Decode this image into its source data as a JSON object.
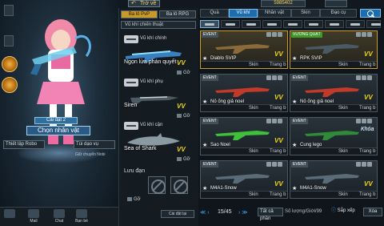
{
  "header": {
    "back_label": "Trở về",
    "currency_value": "5985402"
  },
  "character": {
    "settings_label": "Cài đặt 2",
    "choose_label": "Chọn nhân vật",
    "char_settings_label": "Thiết lập Robo",
    "mount_label": "Tùi dạo vụ",
    "anim_label": "Giữ chuyển Nobi"
  },
  "left_bottom": [
    {
      "label": ""
    },
    {
      "label": "Mail"
    },
    {
      "label": "Chat"
    },
    {
      "label": "Bạn bè"
    }
  ],
  "loadout": {
    "tabs": [
      "Ba lô PvP",
      "Ba lô RPG"
    ],
    "subtab": "Vũ khí chiến thuật",
    "slots": [
      {
        "cat": "Vũ khí chính",
        "name": "Ngọn lửa phán quyết",
        "vv": "VV",
        "stock": "Gỡ"
      },
      {
        "cat": "Vũ khí phụ",
        "name": "Siren",
        "vv": "VV",
        "stock": "Gỡ"
      },
      {
        "cat": "Vũ khí cận",
        "name": "Sea of Shark",
        "vv": "VV",
        "stock": "Gỡ"
      }
    ],
    "items_label": "Lưu đạn",
    "items_stock": "Gỡ",
    "reset_label": "Cài đặt lại"
  },
  "store": {
    "tabs": [
      "Quà",
      "Vũ khí",
      "Nhân vật",
      "Skin",
      "Đạo cụ"
    ],
    "active_tab": 1,
    "cards": [
      {
        "tag": "EVENT",
        "tag_color": "grey",
        "name": "Diablo SVIP",
        "vv": "VV",
        "gold": true,
        "f1": "Skin",
        "f2": "Trang b"
      },
      {
        "tag": "VƯƠNG QUẠT",
        "tag_color": "green",
        "name": "RPK SVIP",
        "vv": "VV",
        "gold": true,
        "f1": "Skin",
        "f2": "Trang b"
      },
      {
        "tag": "EVENT",
        "tag_color": "grey",
        "name": "Nỏ ống giả noel",
        "vv": "VV",
        "gold": false,
        "f1": "Skin",
        "f2": "Trang b"
      },
      {
        "tag": "EVENT",
        "tag_color": "grey",
        "name": "Nỏ ống giả noel",
        "vv": "VV",
        "gold": false,
        "f1": "Skin",
        "f2": "Trang b"
      },
      {
        "tag": "EVENT",
        "tag_color": "grey",
        "name": "Sao Noel",
        "vv": "VV",
        "gold": false,
        "f1": "Skin",
        "f2": "Trang b"
      },
      {
        "tag": "EVENT",
        "tag_color": "grey",
        "name": "Cung lego",
        "vv": "",
        "gold": false,
        "khoa": "Khóa",
        "f1": "Skin",
        "f2": "Trang b"
      },
      {
        "tag": "EVENT",
        "tag_color": "grey",
        "name": "M4A1-Snow",
        "vv": "VV",
        "gold": false,
        "f1": "Skin",
        "f2": "Trang b"
      },
      {
        "tag": "EVENT",
        "tag_color": "grey",
        "name": "M4A1-Snow",
        "vv": "VV",
        "gold": false,
        "f1": "Skin",
        "f2": "Trang b"
      }
    ],
    "footer": {
      "page": "15/45",
      "filter_value": "Tất cả phần",
      "qty_label": "Số lượng/Giới/99",
      "sort_label": "Sắp xếp",
      "clear_label": "Xóa"
    }
  }
}
